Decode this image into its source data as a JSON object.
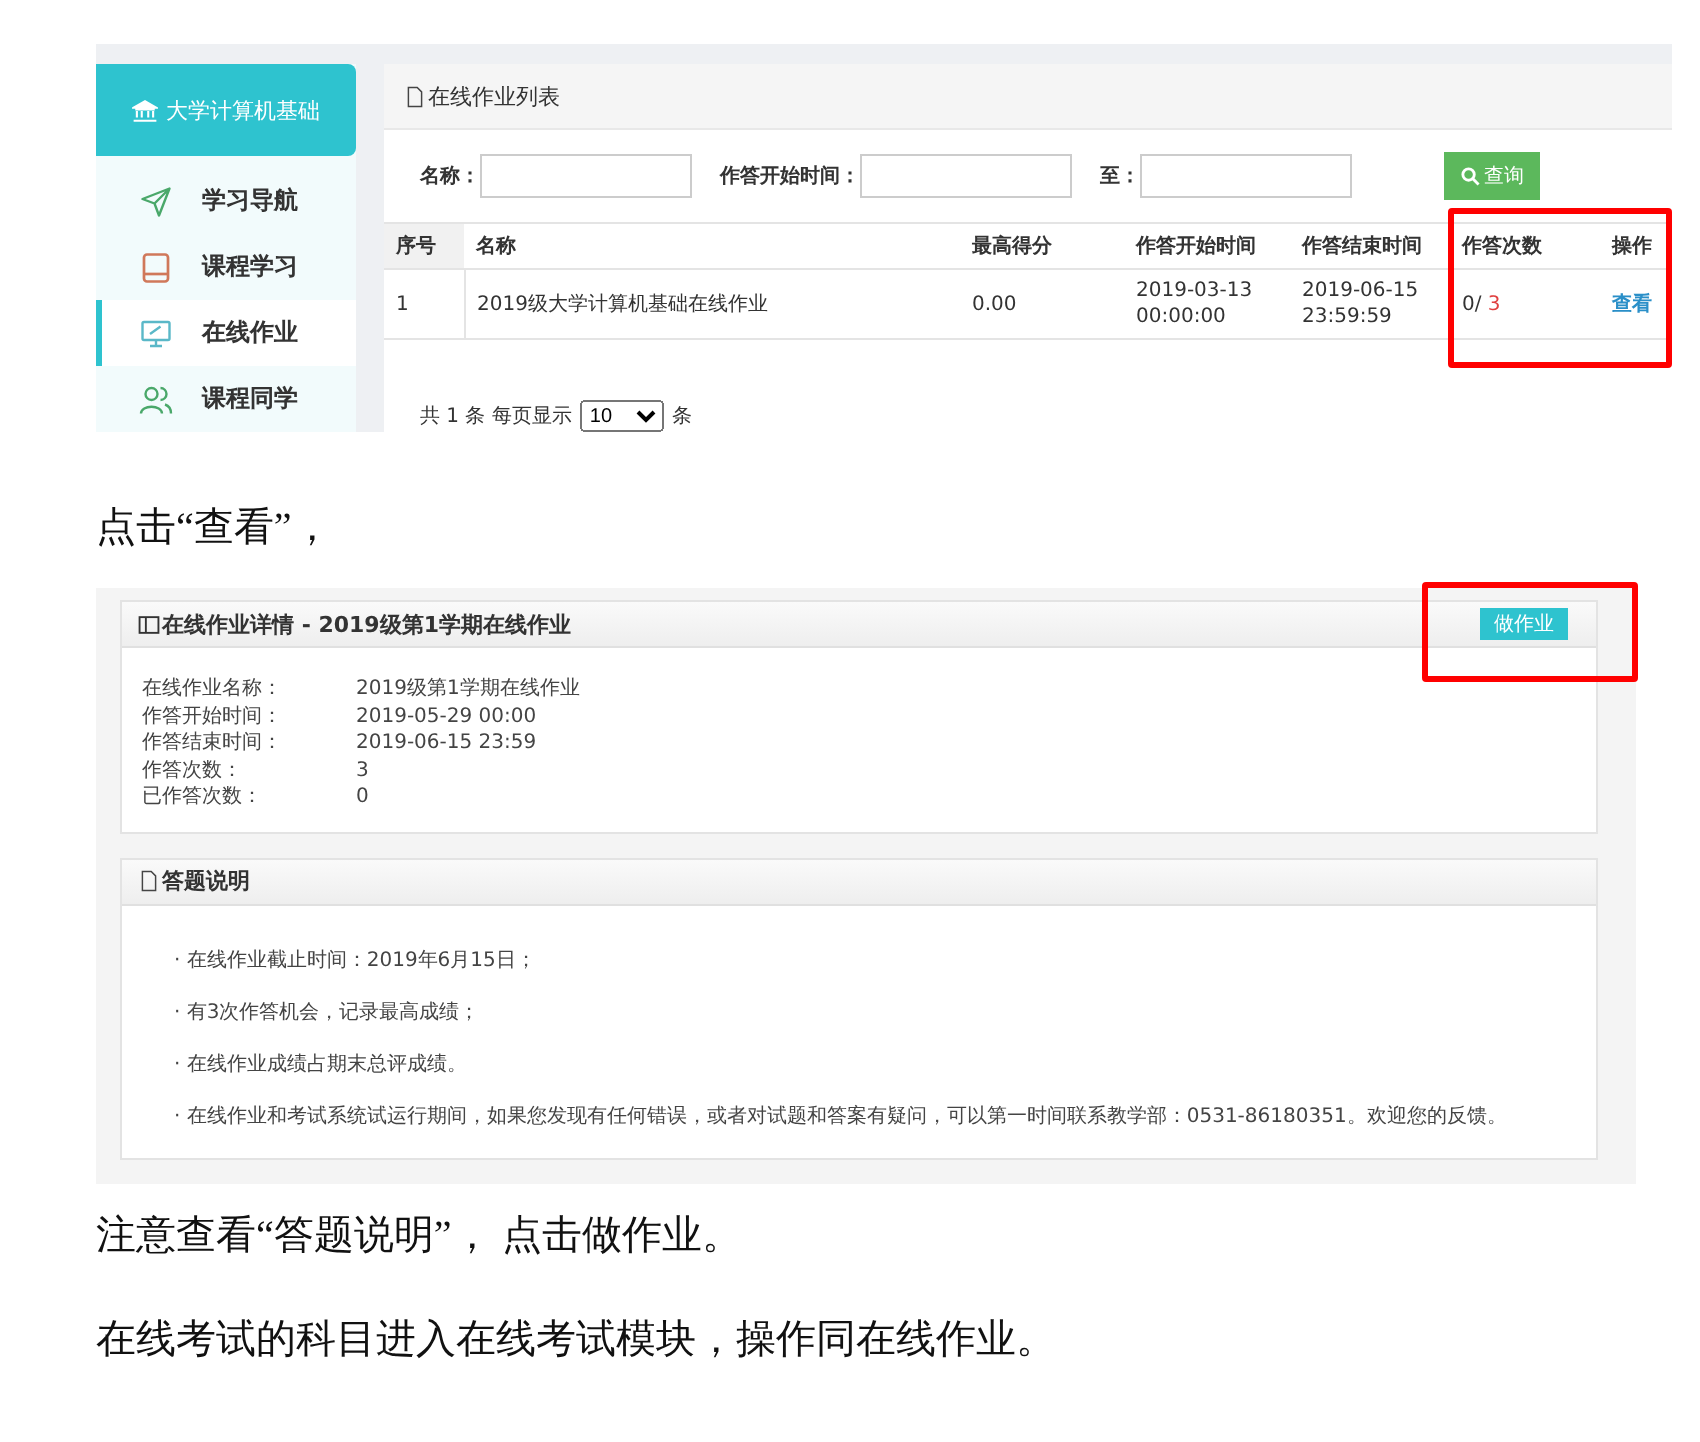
{
  "content": [
    {
      "kind": "list_screen",
      "sidebar": {
        "brand": "大学计算机基础",
        "items": [
          {
            "label": "学习导航",
            "selected": false
          },
          {
            "label": "课程学习",
            "selected": false
          },
          {
            "label": "在线作业",
            "selected": true
          },
          {
            "label": "课程同学",
            "selected": false
          }
        ]
      },
      "panel": {
        "title": "在线作业列表",
        "search": {
          "fields": [
            {
              "label": "名称："
            },
            {
              "label": "作答开始时间："
            },
            {
              "label": "至："
            }
          ],
          "button": "查询"
        },
        "table": {
          "columns": [
            "序号",
            "名称",
            "最高得分",
            "作答开始时间",
            "作答结束时间",
            "作答次数",
            "操作"
          ],
          "rows": [
            {
              "index": "1",
              "name": "2019级大学计算机基础在线作业",
              "best_score": "0.00",
              "start": "2019-03-13 00:00:00",
              "end": "2019-06-15 23:59:59",
              "attempts_used": "0/",
              "attempts_total": "3",
              "action": "查看"
            }
          ]
        },
        "pagination": {
          "prefix": "共 1 条 每页显示",
          "page_size": "10",
          "suffix": "条"
        }
      }
    },
    {
      "kind": "caption",
      "text": "点击“查看”，"
    },
    {
      "kind": "detail_screen",
      "detail": {
        "title": "在线作业详情 - 2019级第1学期在线作业",
        "button": "做作业",
        "fields": [
          {
            "label": "在线作业名称：",
            "value": "2019级第1学期在线作业"
          },
          {
            "label": "作答开始时间：",
            "value": "2019-05-29 00:00"
          },
          {
            "label": "作答结束时间：",
            "value": "2019-06-15 23:59"
          },
          {
            "label": "作答次数：",
            "value": "3"
          },
          {
            "label": "已作答次数：",
            "value": "0"
          }
        ]
      },
      "instructions": {
        "title": "答题说明",
        "items": [
          "· 在线作业截止时间：2019年6月15日；",
          "· 有3次作答机会，记录最高成绩；",
          "· 在线作业成绩占期末总评成绩。",
          "· 在线作业和考试系统试运行期间，如果您发现有任何错误，或者对试题和答案有疑问，可以第一时间联系教学部：0531-86180351。欢迎您的反馈。"
        ]
      }
    },
    {
      "kind": "caption",
      "text": "注意查看“答题说明”， 点击做作业。"
    },
    {
      "kind": "caption",
      "text": "在线考试的科目进入在线考试模块，操作同在线作业。"
    }
  ]
}
